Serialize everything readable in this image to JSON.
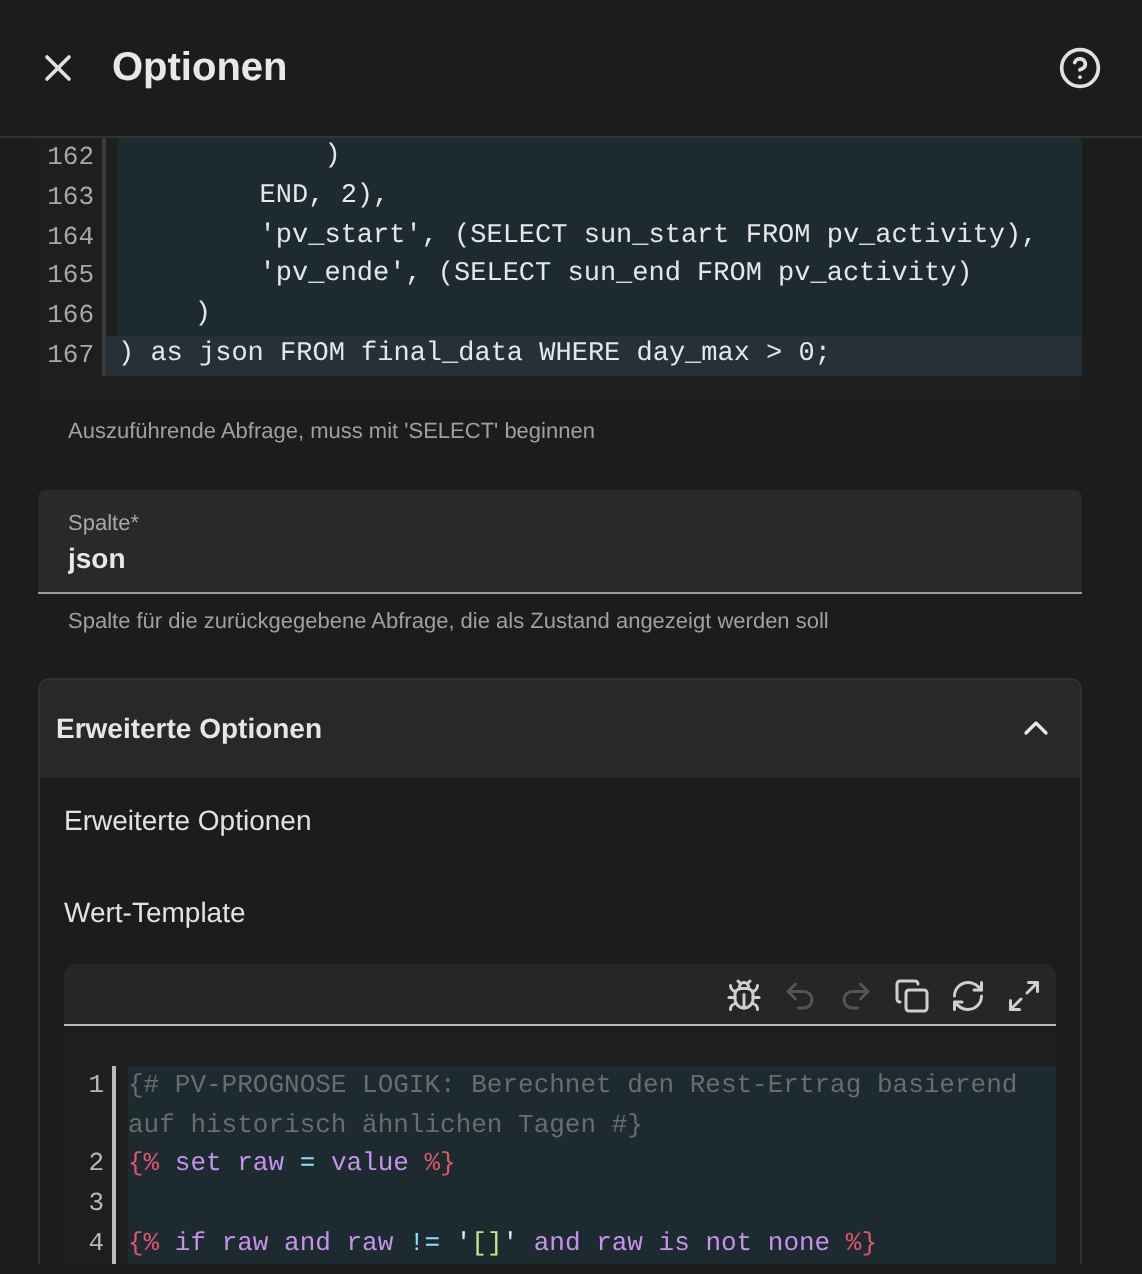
{
  "header": {
    "title": "Optionen"
  },
  "query_editor": {
    "lines": [
      {
        "number": "162",
        "text": "            )",
        "active": false
      },
      {
        "number": "163",
        "text": "        END, 2),",
        "active": false
      },
      {
        "number": "164",
        "text": "        'pv_start', (SELECT sun_start FROM pv_activity),",
        "active": false
      },
      {
        "number": "165",
        "text": "        'pv_ende', (SELECT sun_end FROM pv_activity)",
        "active": false
      },
      {
        "number": "166",
        "text": "    )",
        "active": false
      },
      {
        "number": "167",
        "text": ") as json FROM final_data WHERE day_max > 0;",
        "active": true
      }
    ],
    "helper": "Auszuführende Abfrage, muss mit 'SELECT' beginnen"
  },
  "column_field": {
    "label": "Spalte*",
    "value": "json",
    "helper": "Spalte für die zurückgegebene Abfrage, die als Zustand angezeigt werden soll"
  },
  "advanced_panel": {
    "title": "Erweiterte Optionen",
    "expanded": true,
    "subtitle": "Erweiterte Optionen",
    "template_label": "Wert-Template",
    "toolbar": [
      {
        "kind": "debug",
        "disabled": false
      },
      {
        "kind": "undo",
        "disabled": true
      },
      {
        "kind": "redo",
        "disabled": true
      },
      {
        "kind": "copy",
        "disabled": false
      },
      {
        "kind": "replace",
        "disabled": false
      },
      {
        "kind": "fullscreen",
        "disabled": false
      }
    ],
    "template_lines": [
      {
        "number": "1",
        "tokens": [
          {
            "kind": "comment",
            "text": "{# PV-PROGNOSE LOGIK: Berechnet den Rest-Ertrag basierend auf historisch ähnlichen Tagen #}"
          }
        ]
      },
      {
        "number": "2",
        "tokens": [
          {
            "kind": "delim",
            "text": "{%"
          },
          {
            "kind": "keyword",
            "text": " set raw "
          },
          {
            "kind": "operator",
            "text": "="
          },
          {
            "kind": "keyword",
            "text": " value "
          },
          {
            "kind": "delim",
            "text": "%}"
          }
        ]
      },
      {
        "number": "3"
      },
      {
        "number": "4",
        "tokens": [
          {
            "kind": "delim",
            "text": "{%"
          },
          {
            "kind": "keyword",
            "text": " if raw and raw "
          },
          {
            "kind": "operator",
            "text": "!="
          },
          {
            "kind": "plain",
            "text": " '"
          },
          {
            "kind": "string",
            "text": "[]"
          },
          {
            "kind": "plain",
            "text": "'"
          },
          {
            "kind": "keyword",
            "text": " and raw is not none "
          },
          {
            "kind": "delim",
            "text": "%}"
          }
        ]
      }
    ]
  }
}
